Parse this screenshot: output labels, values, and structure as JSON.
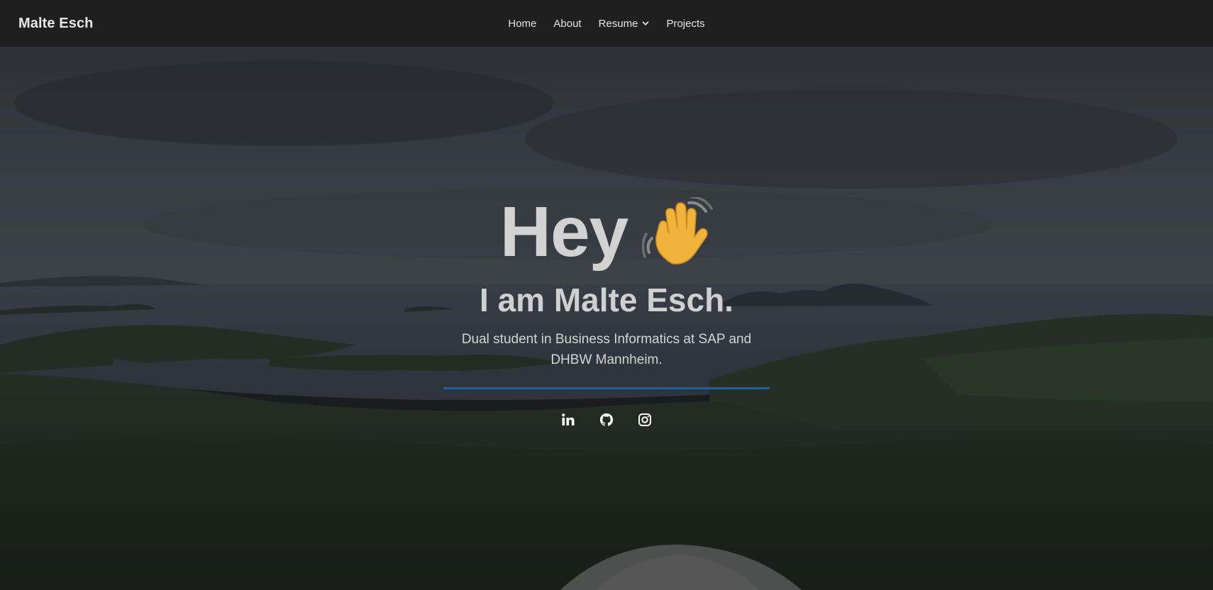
{
  "navbar": {
    "brand": "Malte Esch",
    "links": [
      {
        "label": "Home"
      },
      {
        "label": "About"
      },
      {
        "label": "Resume",
        "dropdown": true
      },
      {
        "label": "Projects"
      }
    ]
  },
  "hero": {
    "greeting": "Hey",
    "greeting_icon": "waving-hand-icon",
    "name": "I am Malte Esch.",
    "description": "Dual student in Business Informatics at SAP and DHBW Mannheim.",
    "socials": [
      {
        "icon": "linkedin-icon"
      },
      {
        "icon": "github-icon"
      },
      {
        "icon": "instagram-icon"
      }
    ]
  },
  "colors": {
    "navbar_bg": "#1f1f1f",
    "divider": "#1f5f9a",
    "text": "#d2d2d2"
  }
}
